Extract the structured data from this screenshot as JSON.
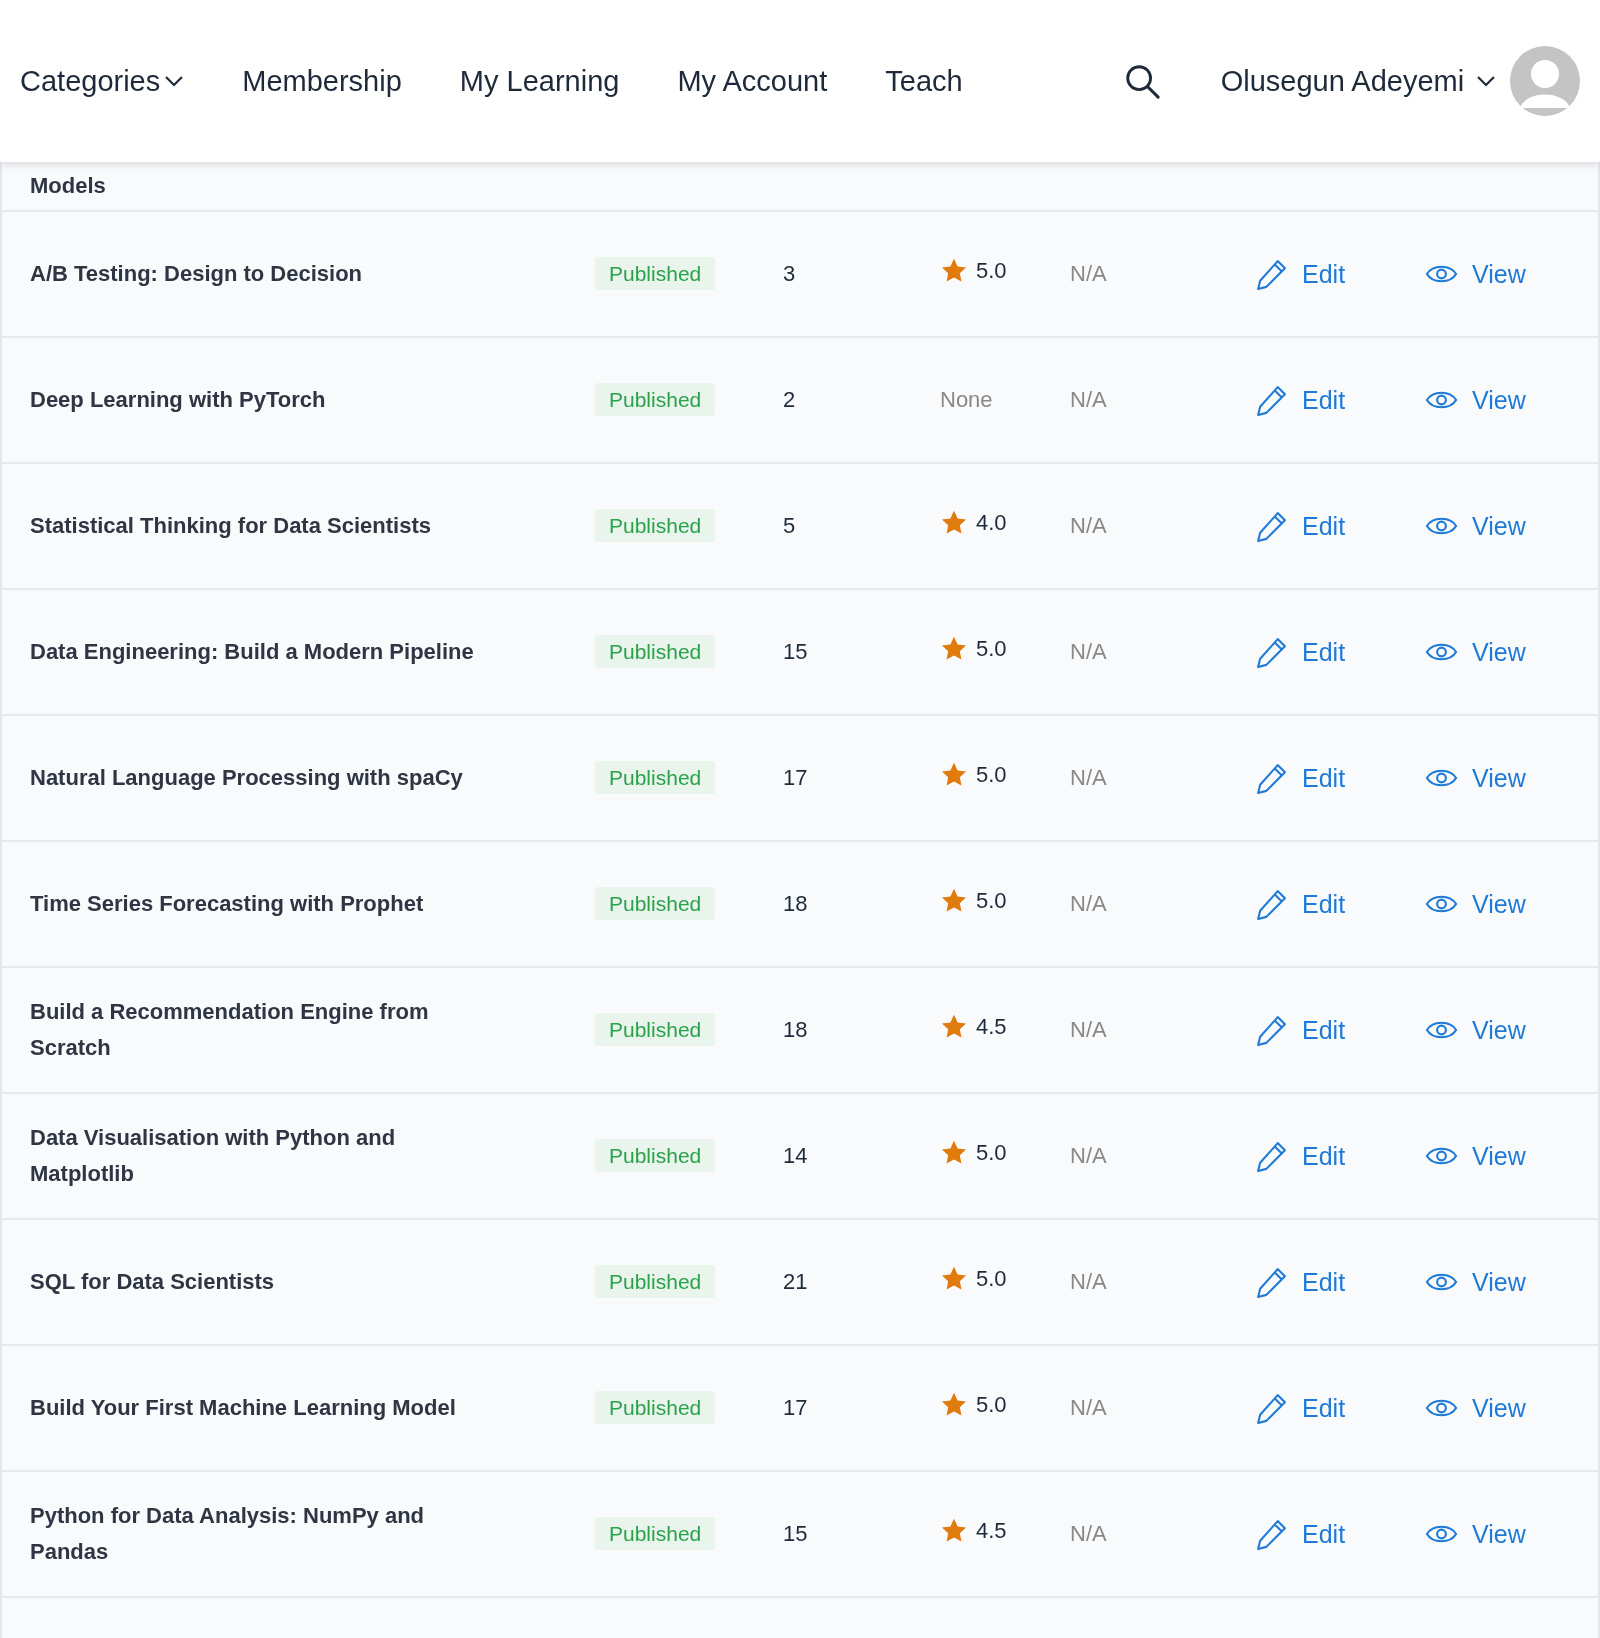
{
  "nav": {
    "items": [
      {
        "label": "Categories",
        "dropdown": true
      },
      {
        "label": "Membership",
        "dropdown": false
      },
      {
        "label": "My Learning",
        "dropdown": false
      },
      {
        "label": "My Account",
        "dropdown": false
      },
      {
        "label": "Teach",
        "dropdown": false
      }
    ],
    "user": "Olusegun Adeyemi"
  },
  "partial_row": {
    "title": "Models"
  },
  "rows": [
    {
      "title": "A/B Testing: Design to Decision",
      "status": "Published",
      "count": "3",
      "kind": "star",
      "rating": "5.0",
      "column_5": "N/A",
      "edit": "Edit",
      "view": "View"
    },
    {
      "title": "Deep Learning with PyTorch",
      "status": "Published",
      "count": "2",
      "kind": "none",
      "rating": "None",
      "column_5": "N/A",
      "edit": "Edit",
      "view": "View"
    },
    {
      "title": "Statistical Thinking for Data Scientists",
      "status": "Published",
      "count": "5",
      "kind": "star",
      "rating": "4.0",
      "column_5": "N/A",
      "edit": "Edit",
      "view": "View"
    },
    {
      "title": "Data Engineering: Build a Modern Pipeline",
      "status": "Published",
      "count": "15",
      "kind": "star",
      "rating": "5.0",
      "column_5": "N/A",
      "edit": "Edit",
      "view": "View"
    },
    {
      "title": "Natural Language Processing with spaCy",
      "status": "Published",
      "count": "17",
      "kind": "star",
      "rating": "5.0",
      "column_5": "N/A",
      "edit": "Edit",
      "view": "View"
    },
    {
      "title": "Time Series Forecasting with Prophet",
      "status": "Published",
      "count": "18",
      "kind": "star",
      "rating": "5.0",
      "column_5": "N/A",
      "edit": "Edit",
      "view": "View"
    },
    {
      "title": "Build a Recommendation Engine from Scratch",
      "status": "Published",
      "count": "18",
      "kind": "star",
      "rating": "4.5",
      "column_5": "N/A",
      "edit": "Edit",
      "view": "View"
    },
    {
      "title": "Data Visualisation with Python and Matplotlib",
      "status": "Published",
      "count": "14",
      "kind": "star",
      "rating": "5.0",
      "column_5": "N/A",
      "edit": "Edit",
      "view": "View"
    },
    {
      "title": "SQL for Data Scientists",
      "status": "Published",
      "count": "21",
      "kind": "star",
      "rating": "5.0",
      "column_5": "N/A",
      "edit": "Edit",
      "view": "View"
    },
    {
      "title": "Build Your First Machine Learning Model",
      "status": "Published",
      "count": "17",
      "kind": "star",
      "rating": "5.0",
      "column_5": "N/A",
      "edit": "Edit",
      "view": "View"
    },
    {
      "title": "Python for Data Analysis: NumPy and Pandas",
      "status": "Published",
      "count": "15",
      "kind": "star",
      "rating": "4.5",
      "column_5": "N/A",
      "edit": "Edit",
      "view": "View"
    }
  ]
}
